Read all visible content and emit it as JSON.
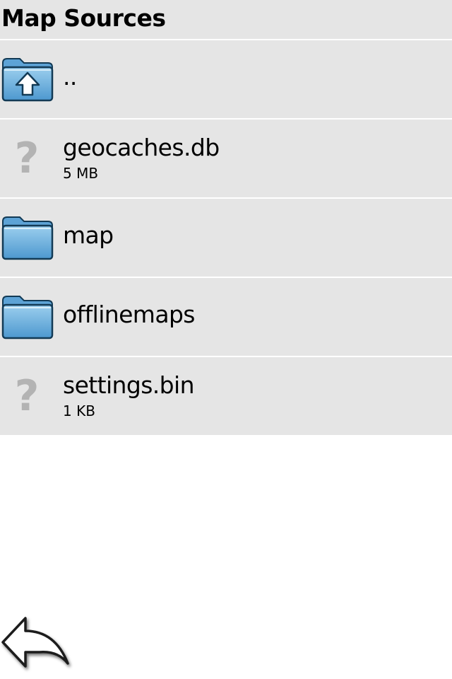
{
  "header": {
    "title": "Map Sources"
  },
  "list": {
    "items": [
      {
        "name": "..",
        "size": "",
        "icon": "folder-up-icon",
        "type": "parent-folder"
      },
      {
        "name": "geocaches.db",
        "size": "5 MB",
        "icon": "unknown-file-icon",
        "type": "file"
      },
      {
        "name": "map",
        "size": "",
        "icon": "folder-icon",
        "type": "folder"
      },
      {
        "name": "offlinemaps",
        "size": "",
        "icon": "folder-icon",
        "type": "folder"
      },
      {
        "name": "settings.bin",
        "size": "1 KB",
        "icon": "unknown-file-icon",
        "type": "file"
      }
    ]
  },
  "footer": {
    "back_icon": "back-arrow-icon"
  },
  "colors": {
    "row_background": "#e5e5e5",
    "folder_blue": "#6fb0de",
    "question_mark_gray": "#b3b3b3"
  }
}
